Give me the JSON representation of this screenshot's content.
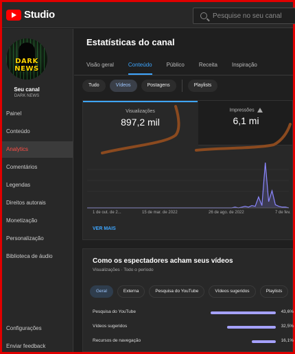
{
  "app": {
    "logo_text": "Studio",
    "search_placeholder": "Pesquise no seu canal"
  },
  "channel": {
    "name": "Seu canal",
    "handle": "DARK NEWS",
    "avatar_text_top": "DARK",
    "avatar_text_bottom": "NEWS"
  },
  "sidebar": {
    "items": [
      {
        "label": "Painel"
      },
      {
        "label": "Conteúdo"
      },
      {
        "label": "Analytics",
        "active": true
      },
      {
        "label": "Comentários"
      },
      {
        "label": "Legendas"
      },
      {
        "label": "Direitos autorais"
      },
      {
        "label": "Monetização"
      },
      {
        "label": "Personalização"
      },
      {
        "label": "Biblioteca de áudio"
      }
    ],
    "bottom": [
      {
        "label": "Configurações"
      },
      {
        "label": "Enviar feedback"
      }
    ]
  },
  "page": {
    "title": "Estatísticas do canal"
  },
  "tabs": [
    {
      "label": "Visão geral"
    },
    {
      "label": "Conteúdo",
      "active": true
    },
    {
      "label": "Público"
    },
    {
      "label": "Receita"
    },
    {
      "label": "Inspiração"
    }
  ],
  "filters": [
    {
      "label": "Tudo"
    },
    {
      "label": "Vídeos",
      "active": true
    },
    {
      "label": "Postagens"
    },
    {
      "label": "Playlists"
    }
  ],
  "metrics": [
    {
      "label": "Visualizações",
      "value": "897,2 mil"
    },
    {
      "label": "Impressões",
      "value": "6,1 mi"
    }
  ],
  "chart_data": {
    "type": "line",
    "x_tick_labels": [
      "1 de out. de 2...",
      "15 de mar. de 2022",
      "26 de ago. de 2022",
      "7 de fev."
    ],
    "description_values": [
      0,
      0,
      0,
      0,
      0,
      0,
      0,
      0,
      0,
      0,
      0,
      0,
      0,
      0,
      0,
      0,
      0,
      0,
      0,
      0,
      0,
      0,
      0,
      0,
      0,
      0,
      0,
      0,
      0,
      0,
      0,
      0,
      0,
      0,
      0,
      0,
      0,
      0,
      0,
      0,
      0,
      0,
      0,
      0,
      1,
      0,
      1,
      2,
      1,
      3,
      2,
      14,
      3,
      58,
      8,
      22,
      4,
      2,
      1,
      1,
      0
    ],
    "grid": true,
    "color": "#8b87ff"
  },
  "see_more": "VER MAIS",
  "viewers": {
    "title": "Como os espectadores acham seus vídeos",
    "subtitle": "Visualizações · Todo o período",
    "chips": [
      {
        "label": "Geral",
        "active": true
      },
      {
        "label": "Externa"
      },
      {
        "label": "Pesquisa do YouTube"
      },
      {
        "label": "Vídeos sugeridos"
      },
      {
        "label": "Playlists"
      }
    ],
    "rows": [
      {
        "label": "Pesquisa do YouTube",
        "value": "43,6%",
        "fraction": 0.436
      },
      {
        "label": "Vídeos sugeridos",
        "value": "32,5%",
        "fraction": 0.325
      },
      {
        "label": "Recursos de navegação",
        "value": "16,1%",
        "fraction": 0.161
      }
    ]
  },
  "colors": {
    "accent": "#3ea6ff",
    "active_nav": "#ff4e45",
    "annotation": "#8b4a1f",
    "bars": "#a5a1ff"
  }
}
